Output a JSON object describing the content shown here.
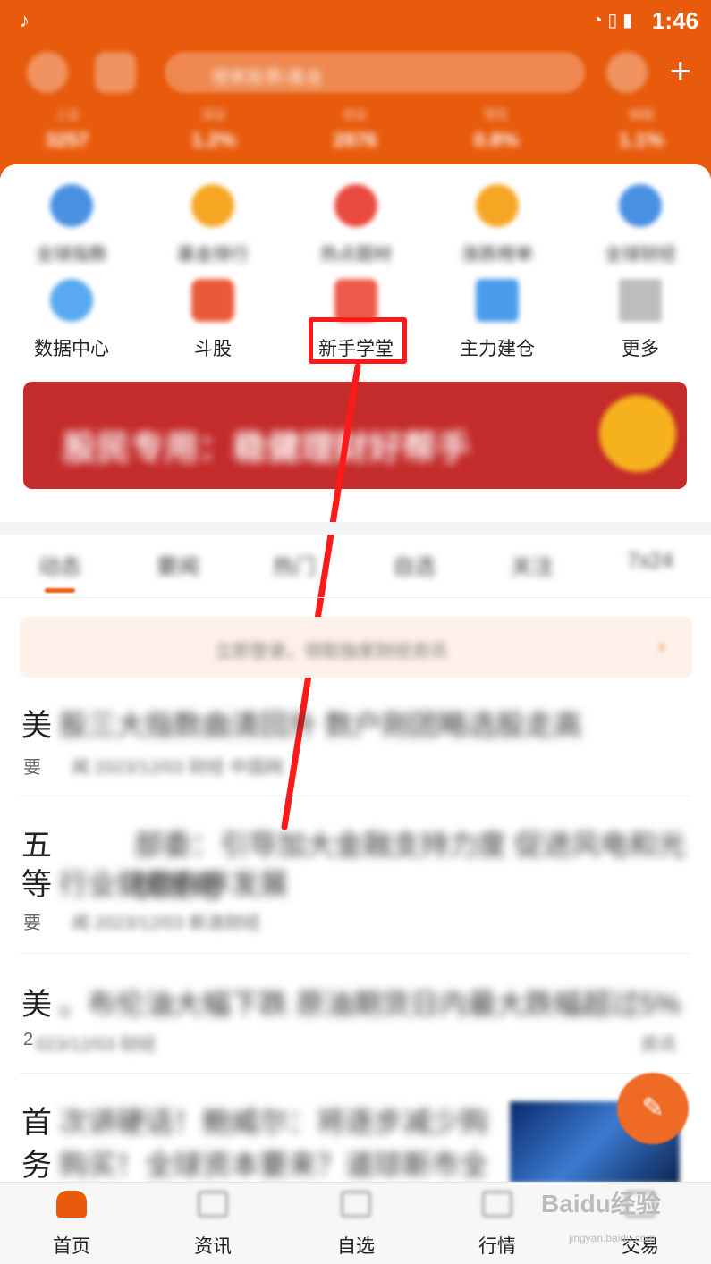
{
  "status_bar": {
    "time": "1:46",
    "left_glyph": "♪",
    "right_glyphs": "◔ ▯ ▮"
  },
  "header": {
    "search_placeholder": "搜索股票/基金",
    "plus": "+",
    "tickers": [
      {
        "name": "上证",
        "value": "3257"
      },
      {
        "name": "深证",
        "value": "1.2%"
      },
      {
        "name": "创业",
        "value": "2876"
      },
      {
        "name": "恒生",
        "value": "0.8%"
      },
      {
        "name": "纳指",
        "value": "1.1%"
      }
    ]
  },
  "quick_row_1": [
    {
      "label": "全球指数",
      "color": "#4a90e2",
      "icon": "globe-icon"
    },
    {
      "label": "基金排行",
      "color": "#f5a623",
      "icon": "coin-icon"
    },
    {
      "label": "热点题材",
      "color": "#e94a3f",
      "icon": "fire-icon"
    },
    {
      "label": "涨跌榜单",
      "color": "#f5a623",
      "icon": "chart-icon"
    },
    {
      "label": "全球财经",
      "color": "#4a90e2",
      "icon": "earth-icon"
    }
  ],
  "quick_row_2": [
    {
      "label": "数据中心",
      "color": "#5aa7f2",
      "icon": "data-center-icon"
    },
    {
      "label": "斗股",
      "color": "#ea5a3a",
      "icon": "battle-icon"
    },
    {
      "label": "新手学堂",
      "color": "#ee5a4a",
      "icon": "school-icon"
    },
    {
      "label": "主力建仓",
      "color": "#4a9be8",
      "icon": "position-icon"
    },
    {
      "label": "更多",
      "color": "#bdbdbd",
      "icon": "more-grid-icon"
    }
  ],
  "banner": {
    "text": "股民专用：稳健理财好帮手"
  },
  "tabs": [
    "动态",
    "要闻",
    "热门",
    "自选",
    "关注",
    "7x24"
  ],
  "notice": {
    "text": "立即登录，领取独家财经资讯",
    "arrow": "›"
  },
  "news": [
    {
      "first": "美",
      "title": "股三大指数曲清回升 数户刚团略选股走高",
      "meta_first": "要",
      "meta": "闻 2023/12/03 财经 中国网"
    },
    {
      "first": "五",
      "title": "部委：引导加大金融支持力度 促进风电和光伏发电",
      "first2": "等",
      "title2": "行业健康有序发展",
      "meta_first": "要",
      "meta": "闻 2023/12/03 新浪财经"
    },
    {
      "first": "美",
      "title": "。布伦油大幅下跌 原油期货日内最大跌幅超过5%",
      "meta_first": "2",
      "meta": "023/12/03 财经",
      "meta_right": "资讯"
    },
    {
      "first": "首",
      "title": "次讲硬话！鲍威尔：将逐步减少购",
      "first2": "务",
      "title2": "购买！全球资本要来？道琼斯市全"
    }
  ],
  "fab": "✎",
  "bottom_nav": [
    {
      "label": "首页"
    },
    {
      "label": "资讯"
    },
    {
      "label": "自选"
    },
    {
      "label": "行情"
    },
    {
      "label": "交易"
    }
  ],
  "watermark": {
    "brand": "Baidu经验",
    "url": "jingyan.baidu.com"
  },
  "highlight_color": "#ff1a1a",
  "accent": "#e85a0c"
}
